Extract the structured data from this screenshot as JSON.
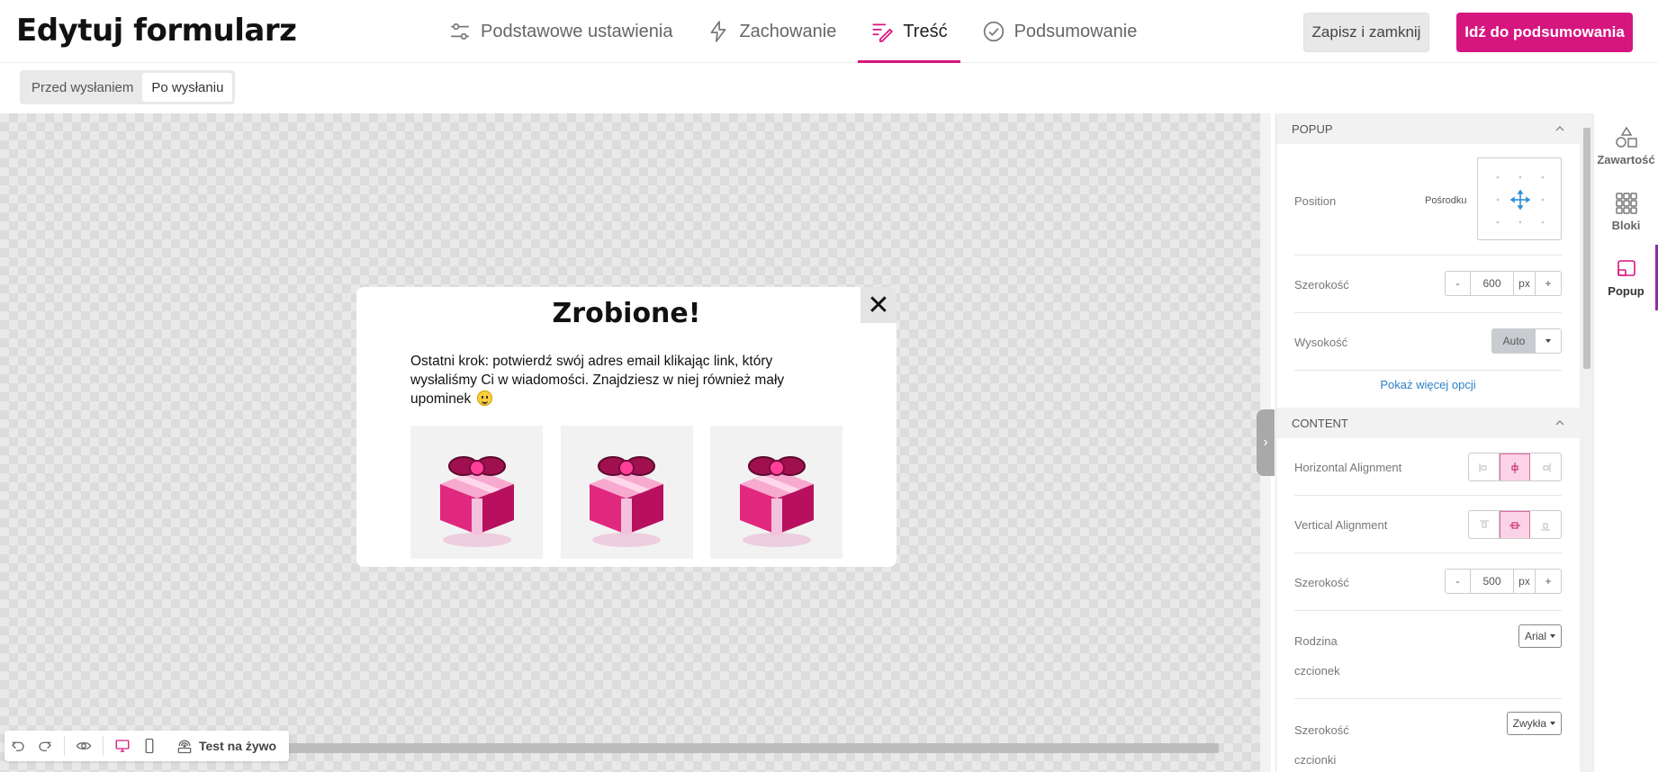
{
  "app": {
    "title": "Edytuj formularz"
  },
  "nav": {
    "tabs": [
      {
        "label": "Podstawowe ustawienia",
        "icon": "sliders-icon"
      },
      {
        "label": "Zachowanie",
        "icon": "lightning-icon"
      },
      {
        "label": "Treść",
        "icon": "edit-lines-icon",
        "active": true
      },
      {
        "label": "Podsumowanie",
        "icon": "check-circle-icon"
      }
    ]
  },
  "actions": {
    "save_close": "Zapisz i zamknij",
    "go_summary": "Idź do podsumowania"
  },
  "subbar": {
    "before_send": "Przed wysłaniem",
    "after_send": "Po wysłaniu",
    "active": "after_send"
  },
  "popup": {
    "close_symbol": "✕",
    "title": "Zrobione!",
    "text": "Ostatni krok: potwierdź swój adres email klikając link, który wysłaliśmy Ci w wiadomości. Znajdziesz w niej również mały upominek",
    "gift_count": 3
  },
  "toolbar": {
    "live_test": "Test na żywo"
  },
  "panel": {
    "popup_section": {
      "title": "POPUP",
      "position_label": "Position",
      "position_value": "Pośrodku",
      "width_label": "Szerokość",
      "width_value": "600",
      "width_unit": "px",
      "height_label": "Wysokość",
      "height_value": "Auto",
      "more_link": "Pokaż więcej opcji"
    },
    "content_section": {
      "title": "CONTENT",
      "h_align_label": "Horizontal Alignment",
      "v_align_label": "Vertical Alignment",
      "width_label": "Szerokość",
      "width_value": "500",
      "width_unit": "px",
      "font_family_label": "Rodzina",
      "font_family_label2": "czcionek",
      "font_family_value": "Arial",
      "font_weight_label": "Szerokość",
      "font_weight_label2": "czcionki",
      "font_weight_value": "Zwykła"
    },
    "stepper_minus": "-",
    "stepper_plus": "+"
  },
  "rail": {
    "items": [
      {
        "label": "Zawartość",
        "icon": "shapes-icon"
      },
      {
        "label": "Bloki",
        "icon": "grid-icon"
      },
      {
        "label": "Popup",
        "icon": "popup-icon",
        "active": true
      }
    ]
  },
  "colors": {
    "accent": "#d6167f",
    "link": "#2f7fc9",
    "rail_active": "#8b2fa0"
  }
}
